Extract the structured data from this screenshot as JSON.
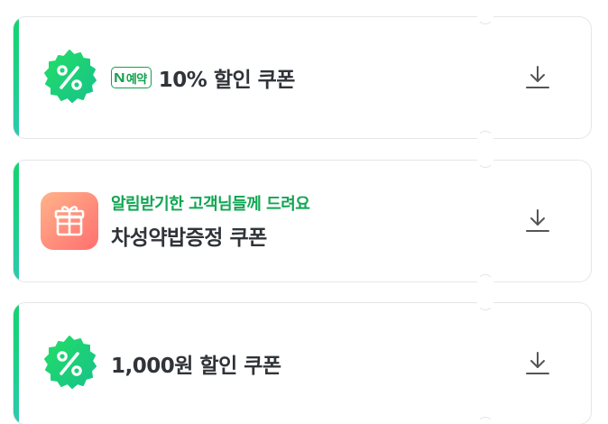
{
  "coupons": [
    {
      "icon": "percent-badge-icon",
      "badge": {
        "logo": "N",
        "text": "예약"
      },
      "title": "10% 할인 쿠폰",
      "action_icon": "download-icon"
    },
    {
      "icon": "gift-icon",
      "subtitle": "알림받기한 고객님들께 드려요",
      "title": "차성약밥증정 쿠폰",
      "action_icon": "download-icon"
    },
    {
      "icon": "percent-badge-icon",
      "title": "1,000원 할인 쿠폰",
      "action_icon": "download-icon"
    }
  ],
  "colors": {
    "accent_green": "#14d36e",
    "badge_green": "#12a04c",
    "subtitle_green": "#11a653",
    "gift_gradient_start": "#ffb38a",
    "gift_gradient_end": "#ff6f6f",
    "title_text": "#303338",
    "border": "#e3e6ea"
  }
}
